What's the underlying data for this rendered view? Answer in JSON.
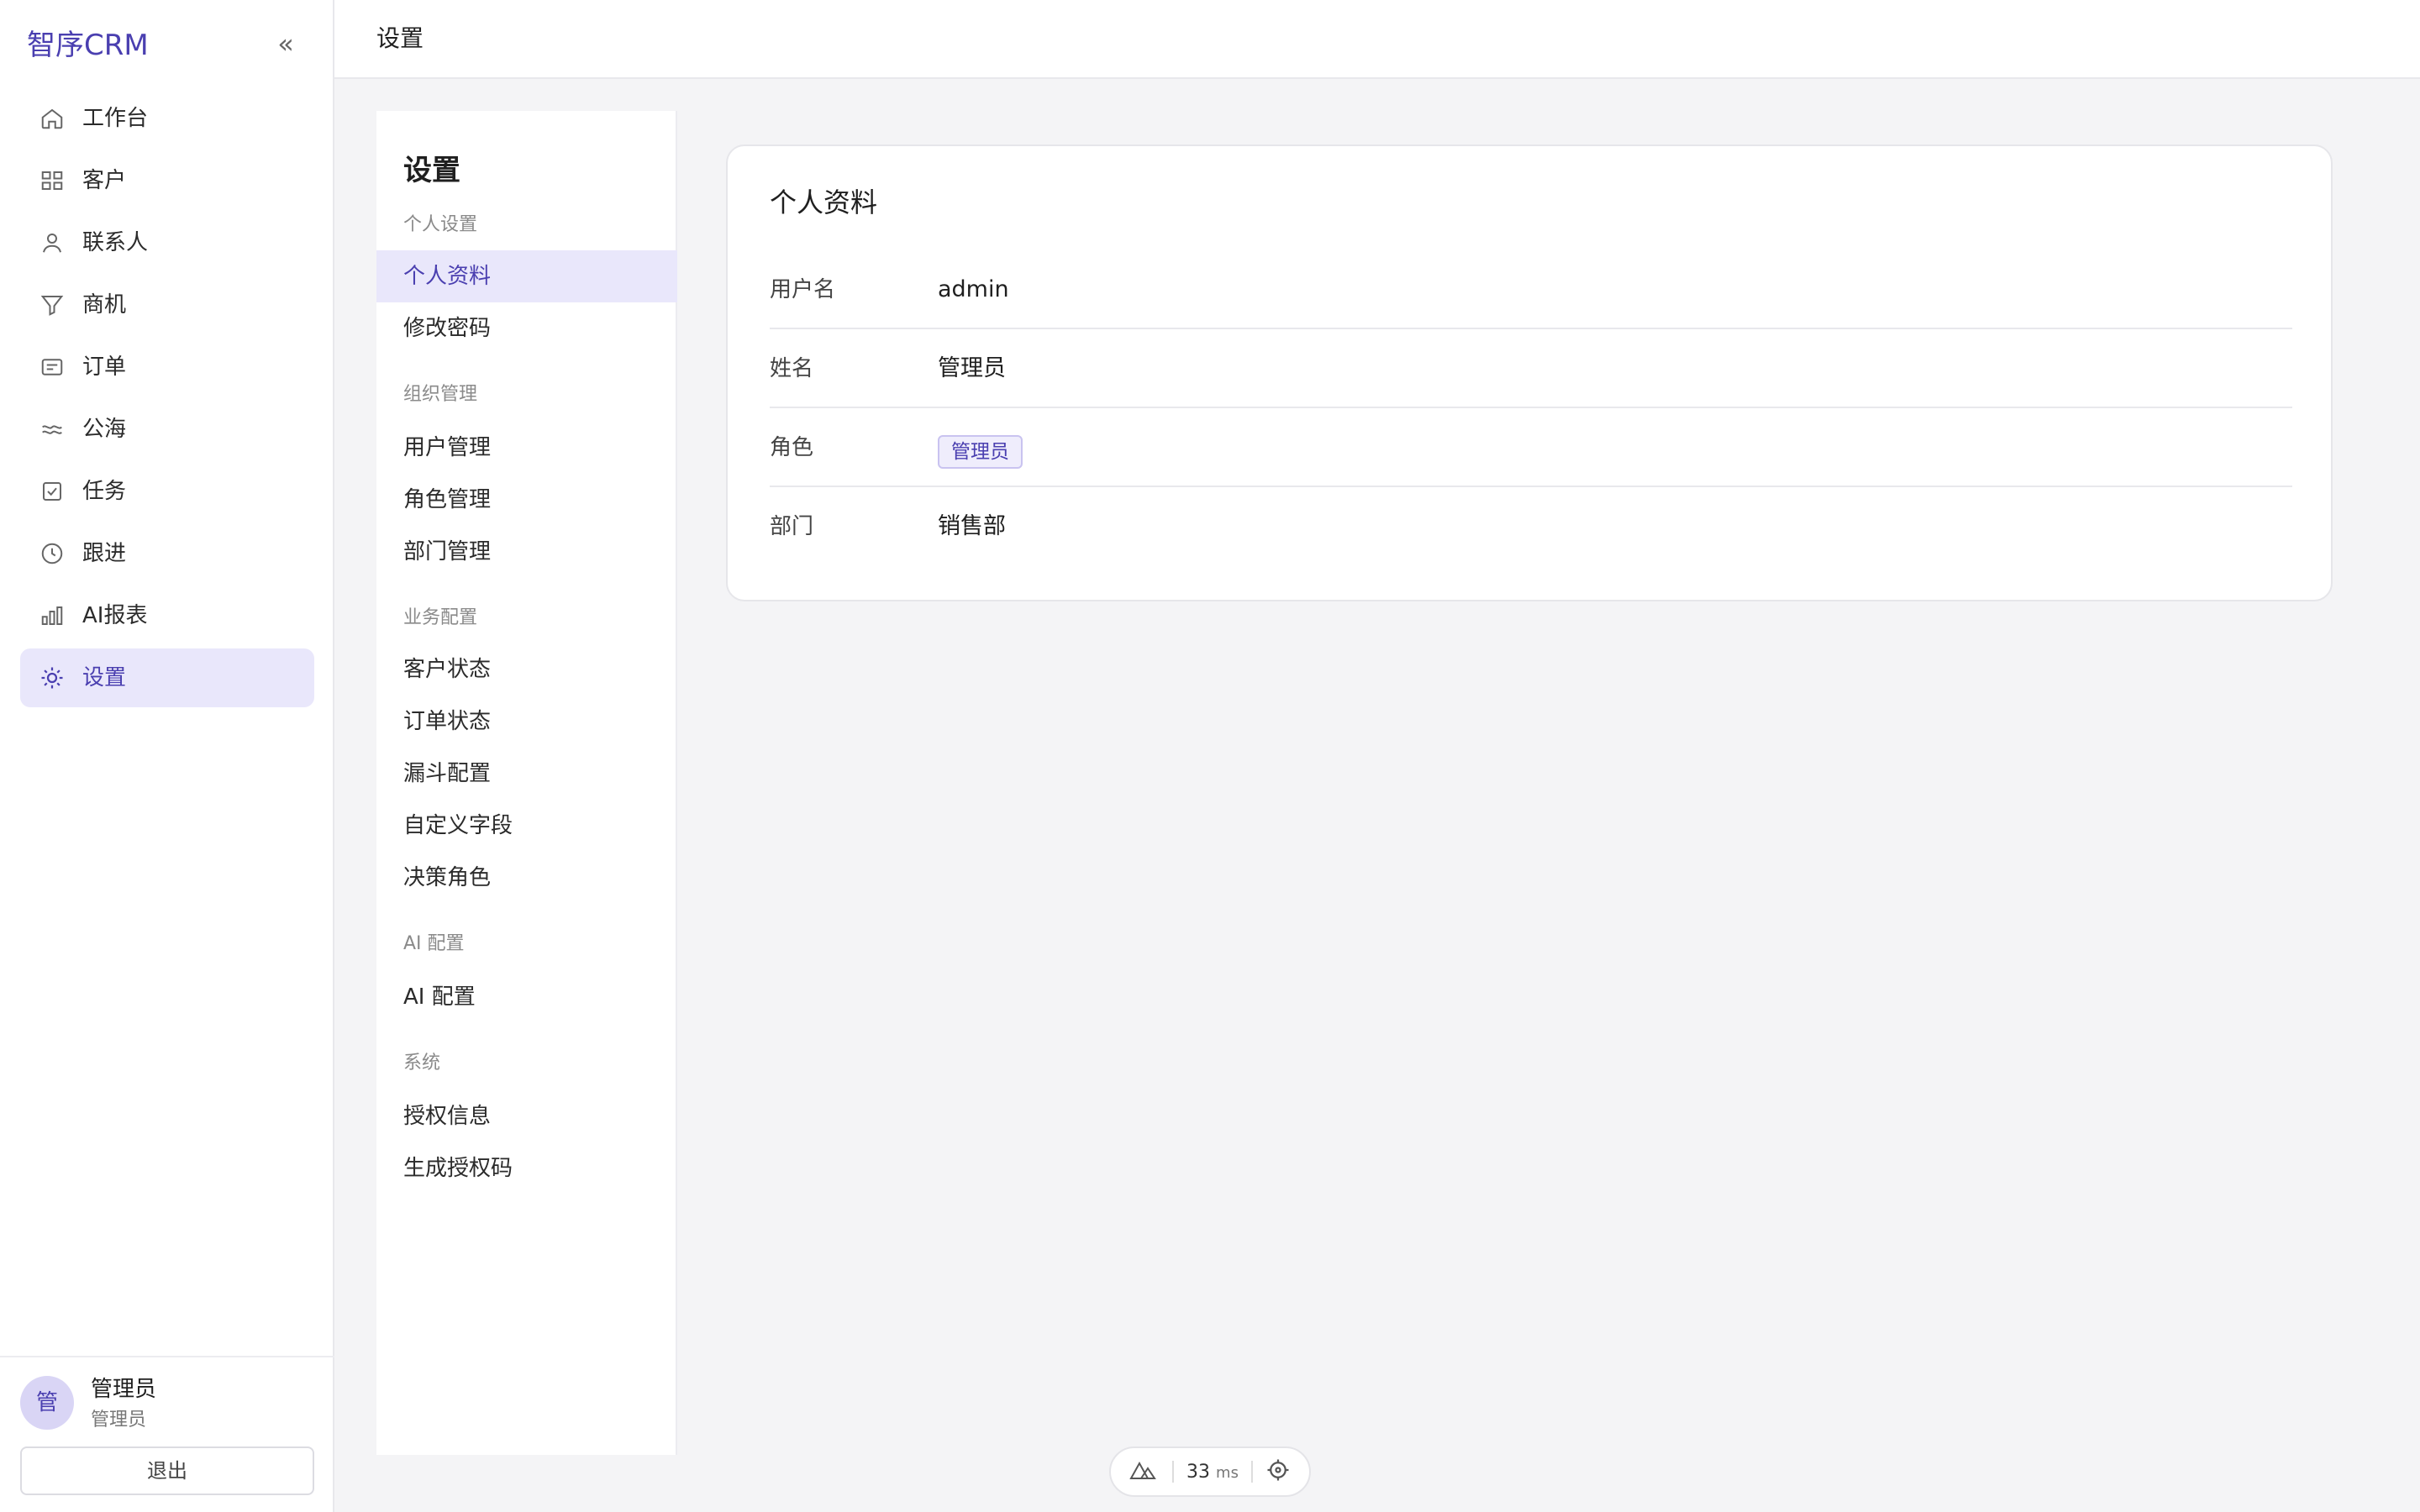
{
  "app": {
    "brand": "智序CRM",
    "collapse_glyph": "«"
  },
  "sidebar": {
    "items": [
      {
        "label": "工作台",
        "icon": "home-icon"
      },
      {
        "label": "客户",
        "icon": "grid-icon"
      },
      {
        "label": "联系人",
        "icon": "user-icon"
      },
      {
        "label": "商机",
        "icon": "funnel-icon"
      },
      {
        "label": "订单",
        "icon": "order-icon"
      },
      {
        "label": "公海",
        "icon": "waves-icon"
      },
      {
        "label": "任务",
        "icon": "task-icon"
      },
      {
        "label": "跟进",
        "icon": "clock-icon"
      },
      {
        "label": "AI报表",
        "icon": "bar-chart-icon"
      },
      {
        "label": "设置",
        "icon": "gear-icon",
        "active": true
      }
    ],
    "user": {
      "avatar_text": "管",
      "name": "管理员",
      "role": "管理员",
      "logout": "退出"
    }
  },
  "header": {
    "title": "设置"
  },
  "subnav": {
    "title": "设置",
    "groups": [
      {
        "label": "个人设置",
        "items": [
          "个人资料",
          "修改密码"
        ]
      },
      {
        "label": "组织管理",
        "items": [
          "用户管理",
          "角色管理",
          "部门管理"
        ]
      },
      {
        "label": "业务配置",
        "items": [
          "客户状态",
          "订单状态",
          "漏斗配置",
          "自定义字段",
          "决策角色"
        ]
      },
      {
        "label": "AI 配置",
        "items": [
          "AI 配置"
        ]
      },
      {
        "label": "系统",
        "items": [
          "授权信息",
          "生成授权码"
        ]
      }
    ],
    "active": "个人资料"
  },
  "profile": {
    "title": "个人资料",
    "fields": [
      {
        "key": "用户名",
        "value": "admin"
      },
      {
        "key": "姓名",
        "value": "管理员"
      },
      {
        "key": "角色",
        "value": "管理员"
      },
      {
        "key": "部门",
        "value": "销售部"
      }
    ]
  },
  "devpill": {
    "ms_value": "33",
    "ms_unit": "ms"
  },
  "colors": {
    "accent": "#4a3fb0",
    "active_bg": "#e9e7fb",
    "page_bg": "#f4f4f6"
  }
}
